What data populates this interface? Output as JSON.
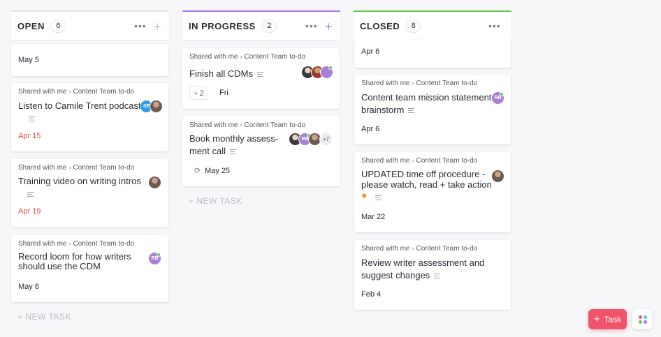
{
  "columns": [
    {
      "title": "OPEN",
      "count": "6",
      "new_task": "+ NEW TASK",
      "accent": "#e4e4e8"
    },
    {
      "title": "IN PROGRESS",
      "count": "2",
      "new_task": "+ NEW TASK",
      "accent": "#a875ff"
    },
    {
      "title": "CLOSED",
      "count": "8",
      "accent": "#6bc950"
    }
  ],
  "crumb": {
    "shared": "Shared with me",
    "list": "Content Team to-do"
  },
  "open_cards": [
    {
      "date": "May 5"
    },
    {
      "title": "Listen to Camile Trent podcast",
      "date": "Apr 15",
      "avatar": "SP"
    },
    {
      "title": "Training video on writing intros",
      "date": "Apr 19"
    },
    {
      "title_line1": "Record loom for how writers",
      "title_line2": "should use the CDM",
      "date": "May 6",
      "avatar": "RB"
    }
  ],
  "progress_cards": [
    {
      "title": "Finish all CDMs",
      "subtasks": "2",
      "date": "Fri"
    },
    {
      "title_line1": "Book monthly assess-",
      "title_line2": "ment call",
      "date": "May 25",
      "avatar": "RB",
      "more": "+7"
    }
  ],
  "closed_cards": [
    {
      "date": "Apr 6"
    },
    {
      "title_line1": "Content team mission statement",
      "title_line2": "brainstorm",
      "date": "Apr 6",
      "avatar": "RB"
    },
    {
      "title_line1": "UPDATED time off procedure -",
      "title_line2": "please watch, read + take action",
      "date": "Mar 22"
    },
    {
      "title_line1": "Review writer assessment and",
      "title_line2": "suggest changes",
      "date": "Feb 4"
    }
  ],
  "fab": {
    "label": "Task"
  },
  "colors": {
    "accent": "#f0546b",
    "due_overdue": "#e44c3c",
    "in_progress": "#a875ff",
    "closed": "#6bc950"
  }
}
